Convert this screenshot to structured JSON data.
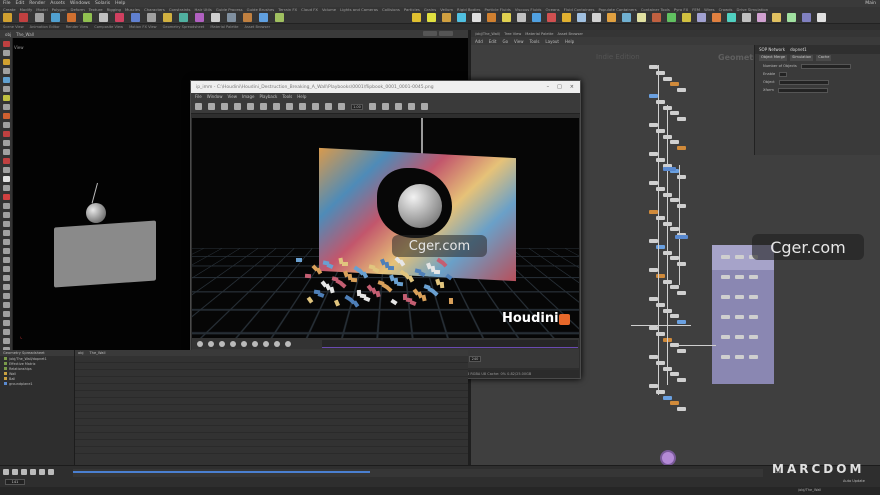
{
  "app": {
    "menus": [
      "File",
      "Edit",
      "Render",
      "Assets",
      "Windows",
      "Solaris",
      "Help"
    ],
    "desktop": "Main"
  },
  "shelf": {
    "tabs": [
      "Create",
      "Modify",
      "Model",
      "Polygon",
      "Deform",
      "Texture",
      "Rigging",
      "Muscles",
      "Characters",
      "Constraints",
      "Hair Utils",
      "Guide Process",
      "Guide Brushes",
      "Terrain FX",
      "Cloud FX",
      "Volume",
      "Lights and Cameras",
      "Collisions",
      "Particles",
      "Grains",
      "Vellum",
      "Rigid Bodies",
      "Particle Fluids",
      "Viscous Fluids",
      "Oceans",
      "Fluid Containers",
      "Populate Containers",
      "Container Tools",
      "Pyro FX",
      "FEM",
      "Wires",
      "Crowds",
      "Drive Simulation"
    ],
    "tool_colors": [
      "#d0a030",
      "#c04040",
      "#a0a0a0",
      "#50a0d0",
      "#d07030",
      "#90c050",
      "#c0c0c0",
      "#d04060",
      "#6080d0",
      "#a0a0a0",
      "#d0b040",
      "#50b0a0",
      "#b060c0",
      "#d0d0d0",
      "#8090a0",
      "#c08040",
      "#60a0e0",
      "#a0c060"
    ],
    "tool_colors_right": [
      "#e0c030",
      "#e0e040",
      "#d0a040",
      "#50c0e0",
      "#e0e0e0",
      "#d08030",
      "#e0d050",
      "#c0c0c0",
      "#50a0e0",
      "#d05050",
      "#e0b030",
      "#a0c0e0",
      "#d0d0d0",
      "#e0a040",
      "#70b0d0",
      "#e0e0a0",
      "#c06040",
      "#60c060",
      "#d0c040",
      "#a0a0d0",
      "#e08040",
      "#50d0c0",
      "#c0c0c0",
      "#d0a0d0",
      "#e0c060",
      "#a0e0a0",
      "#8080c0",
      "#e0e0e0"
    ],
    "row2": [
      "Scene View",
      "Animation Editor",
      "Render View",
      "Composite View",
      "Motion FX View",
      "Geometry Spreadsheet",
      "Material Palette",
      "Asset Browser"
    ]
  },
  "viewport": {
    "header_items": [
      "obj",
      "The_Wall"
    ],
    "tab_label": "View",
    "left_tool_colors": [
      "#c04040",
      "#a0a0a0",
      "#d0a030",
      "#a0a0a0",
      "#60a0d0",
      "#a0a0a0",
      "#c0c040",
      "#a0a0a0",
      "#d06030",
      "#a0a0a0",
      "#c04040",
      "#a0a0a0",
      "#a0a0a0",
      "#c04040",
      "#a0a0a0",
      "#e0e0e0",
      "#a0a0a0",
      "#d04040",
      "#a0a0a0",
      "#a0a0a0",
      "#a0a0a0",
      "#a0a0a0",
      "#a0a0a0",
      "#a0a0a0",
      "#a0a0a0",
      "#a0a0a0",
      "#a0a0a0",
      "#a0a0a0",
      "#a0a0a0",
      "#a0a0a0",
      "#a0a0a0",
      "#a0a0a0",
      "#a0a0a0",
      "#a0a0a0",
      "#a0a0a0"
    ]
  },
  "mplay": {
    "title": "ip_imm - C:\\Houdini\\Houdini_Destruction_Breaking_A_Wall\\Playbooks\\0001\\flipbook_0001_0001-0045.png",
    "menus": [
      "File",
      "Window",
      "View",
      "Image",
      "Playback",
      "Tools",
      "Help"
    ],
    "frame_field": "1.00",
    "logo": "Houdini",
    "frame_start": "24/24",
    "frame_end": "24/24",
    "current": "141",
    "range_end": "240",
    "range_end2": "240",
    "status_left": "Pixel: 386, 142; RGBA: 68 39 43 39 255",
    "status_right": "Image: 1280x720 0.78 RGBA U8  Cache: 0% 0.82/25.00GB"
  },
  "network": {
    "path_tabs": [
      "/obj/The_Wall/",
      "Tree View",
      "Material Palette",
      "Asset Browser"
    ],
    "path_items": [
      "Add",
      "Edit",
      "Go",
      "View",
      "Tools",
      "Layout",
      "Help"
    ],
    "title": "Geometry",
    "subtitle": "Indie Edition"
  },
  "params": {
    "header": "SOP Network",
    "node_name": "dopnet1",
    "tabs": [
      "Object Merge",
      "Simulation",
      "Cache"
    ],
    "rows": [
      "Number of Objects",
      "Enable",
      "Object",
      "Xform"
    ]
  },
  "watermarks": {
    "left": "Cger.com",
    "right": "Cger.com",
    "brand": "MARCDOM"
  },
  "tree": {
    "header": "Geometry Spreadsheet",
    "items": [
      "/obj/The_Wall/dopnet1",
      "Effective Matrix",
      "Relationships",
      "Wall",
      "Ball",
      "groundplane1"
    ],
    "swatches": [
      "#7a9a4a",
      "#7a9a4a",
      "#7a9a4a",
      "#c8a040",
      "#c8a040",
      "#5a8ad0"
    ]
  },
  "bottompane": {
    "header": [
      "obj",
      "The_Wall"
    ]
  },
  "timeline": {
    "frame": "141",
    "end": "240",
    "auto": "Auto Update",
    "cache_fraction": 0.43
  },
  "statusbar": {
    "path": "/obj/The_Wall"
  }
}
